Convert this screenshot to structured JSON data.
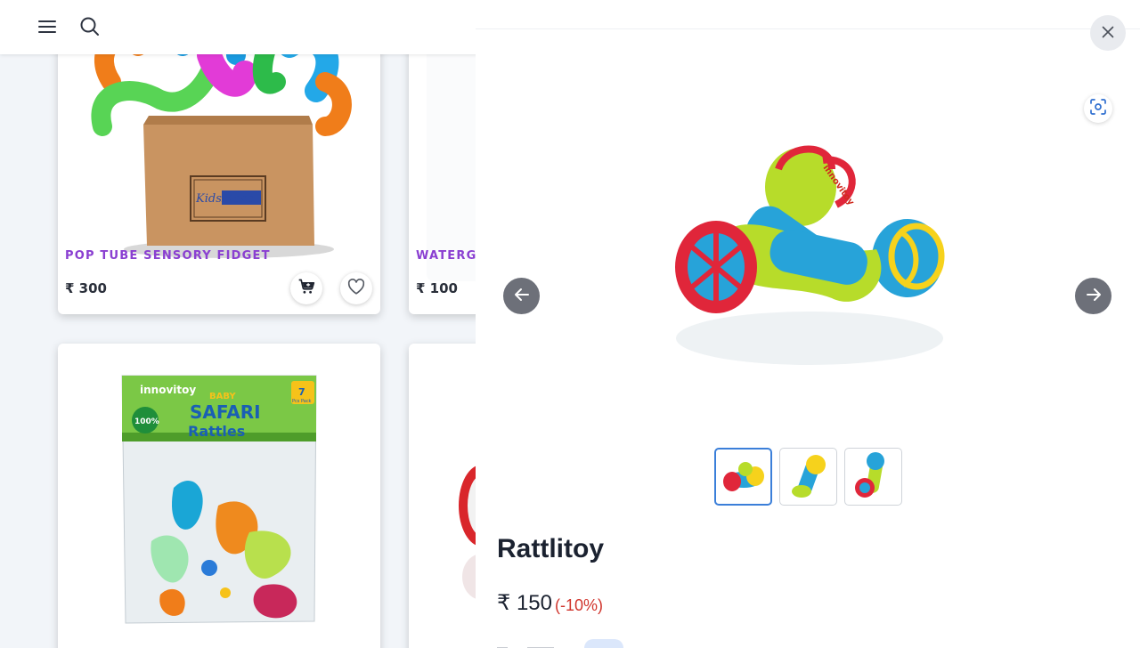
{
  "header": {
    "menu_icon": "hamburger-menu-icon",
    "search_icon": "search-icon"
  },
  "products": [
    {
      "title": "POP TUBE SENSORY FIDGET",
      "price": "₹ 300",
      "box_brand": "KidsMandi",
      "cart_icon": "cart-icon",
      "wishlist_icon": "heart-icon"
    },
    {
      "title": "WATERGA",
      "price": "₹ 100"
    },
    {
      "package_brand": "innovitoy",
      "package_title_line1": "BABY",
      "package_title_line2": "SAFARI",
      "package_title_line3": "Rattles",
      "package_badge": "100%",
      "package_pieces": "7",
      "package_pieces_label": "Pcs Pack"
    },
    {}
  ],
  "drawer": {
    "close_icon": "close-icon",
    "scan_icon": "scan-focus-icon",
    "prev_icon": "arrow-left-icon",
    "next_icon": "arrow-right-icon",
    "image_brand": "innovitoy",
    "thumbnails": [
      "rattle-thumbnail-1",
      "rattle-thumbnail-2",
      "rattle-thumbnail-3"
    ],
    "product_name": "Rattlitoy",
    "price": "₹ 150",
    "discount": "(-10%)"
  },
  "colors": {
    "accent_purple": "#8a3fd1",
    "discount_red": "#d0342c",
    "thumb_active_border": "#3b7fd9"
  }
}
